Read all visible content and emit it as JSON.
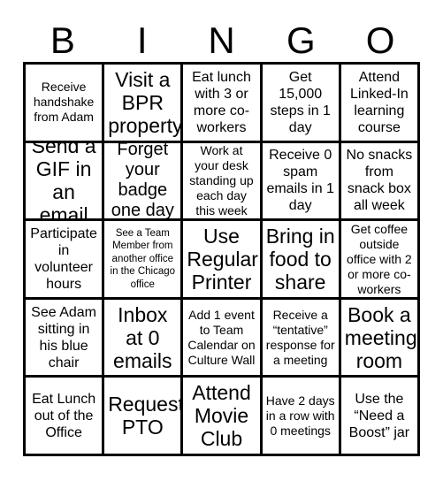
{
  "card": {
    "title": "BINGO",
    "header_letters": [
      "B",
      "I",
      "N",
      "G",
      "O"
    ],
    "grid_size": "5x5",
    "colors": {
      "border": "#000000",
      "background": "#ffffff",
      "text": "#000000"
    },
    "rows": [
      [
        {
          "text": "Receive handshake from Adam",
          "size": "sm"
        },
        {
          "text": "Visit a BPR property",
          "size": "xl"
        },
        {
          "text": "Eat lunch with 3 or more co-workers",
          "size": "md"
        },
        {
          "text": "Get 15,000 steps in 1 day",
          "size": "md"
        },
        {
          "text": "Attend Linked-In learning course",
          "size": "md"
        }
      ],
      [
        {
          "text": "Send a GIF in an email",
          "size": "xl"
        },
        {
          "text": "Forget your badge one day",
          "size": "lg"
        },
        {
          "text": "Work at your desk standing up each day this week",
          "size": "sm"
        },
        {
          "text": "Receive 0 spam emails in 1 day",
          "size": "md"
        },
        {
          "text": "No snacks from snack box all week",
          "size": "md"
        }
      ],
      [
        {
          "text": "Participate in volunteer hours",
          "size": "md"
        },
        {
          "text": "See a Team Member from another office in the Chicago office",
          "size": "xs"
        },
        {
          "text": "Use Regular Printer",
          "size": "xl"
        },
        {
          "text": "Bring in food to share",
          "size": "xl"
        },
        {
          "text": "Get coffee outside office with 2 or more co-workers",
          "size": "sm"
        }
      ],
      [
        {
          "text": "See Adam sitting in his blue chair",
          "size": "md"
        },
        {
          "text": "Inbox at 0 emails",
          "size": "xl"
        },
        {
          "text": "Add 1 event to Team Calendar on Culture Wall",
          "size": "sm"
        },
        {
          "text": "Receive a “tentative” response for a meeting",
          "size": "sm"
        },
        {
          "text": "Book a meeting room",
          "size": "xl"
        }
      ],
      [
        {
          "text": "Eat Lunch out of the Office",
          "size": "md"
        },
        {
          "text": "Request PTO",
          "size": "xl"
        },
        {
          "text": "Attend Movie Club",
          "size": "xl"
        },
        {
          "text": "Have 2 days in a row with 0 meetings",
          "size": "sm"
        },
        {
          "text": "Use the “Need a Boost” jar",
          "size": "md"
        }
      ]
    ]
  }
}
